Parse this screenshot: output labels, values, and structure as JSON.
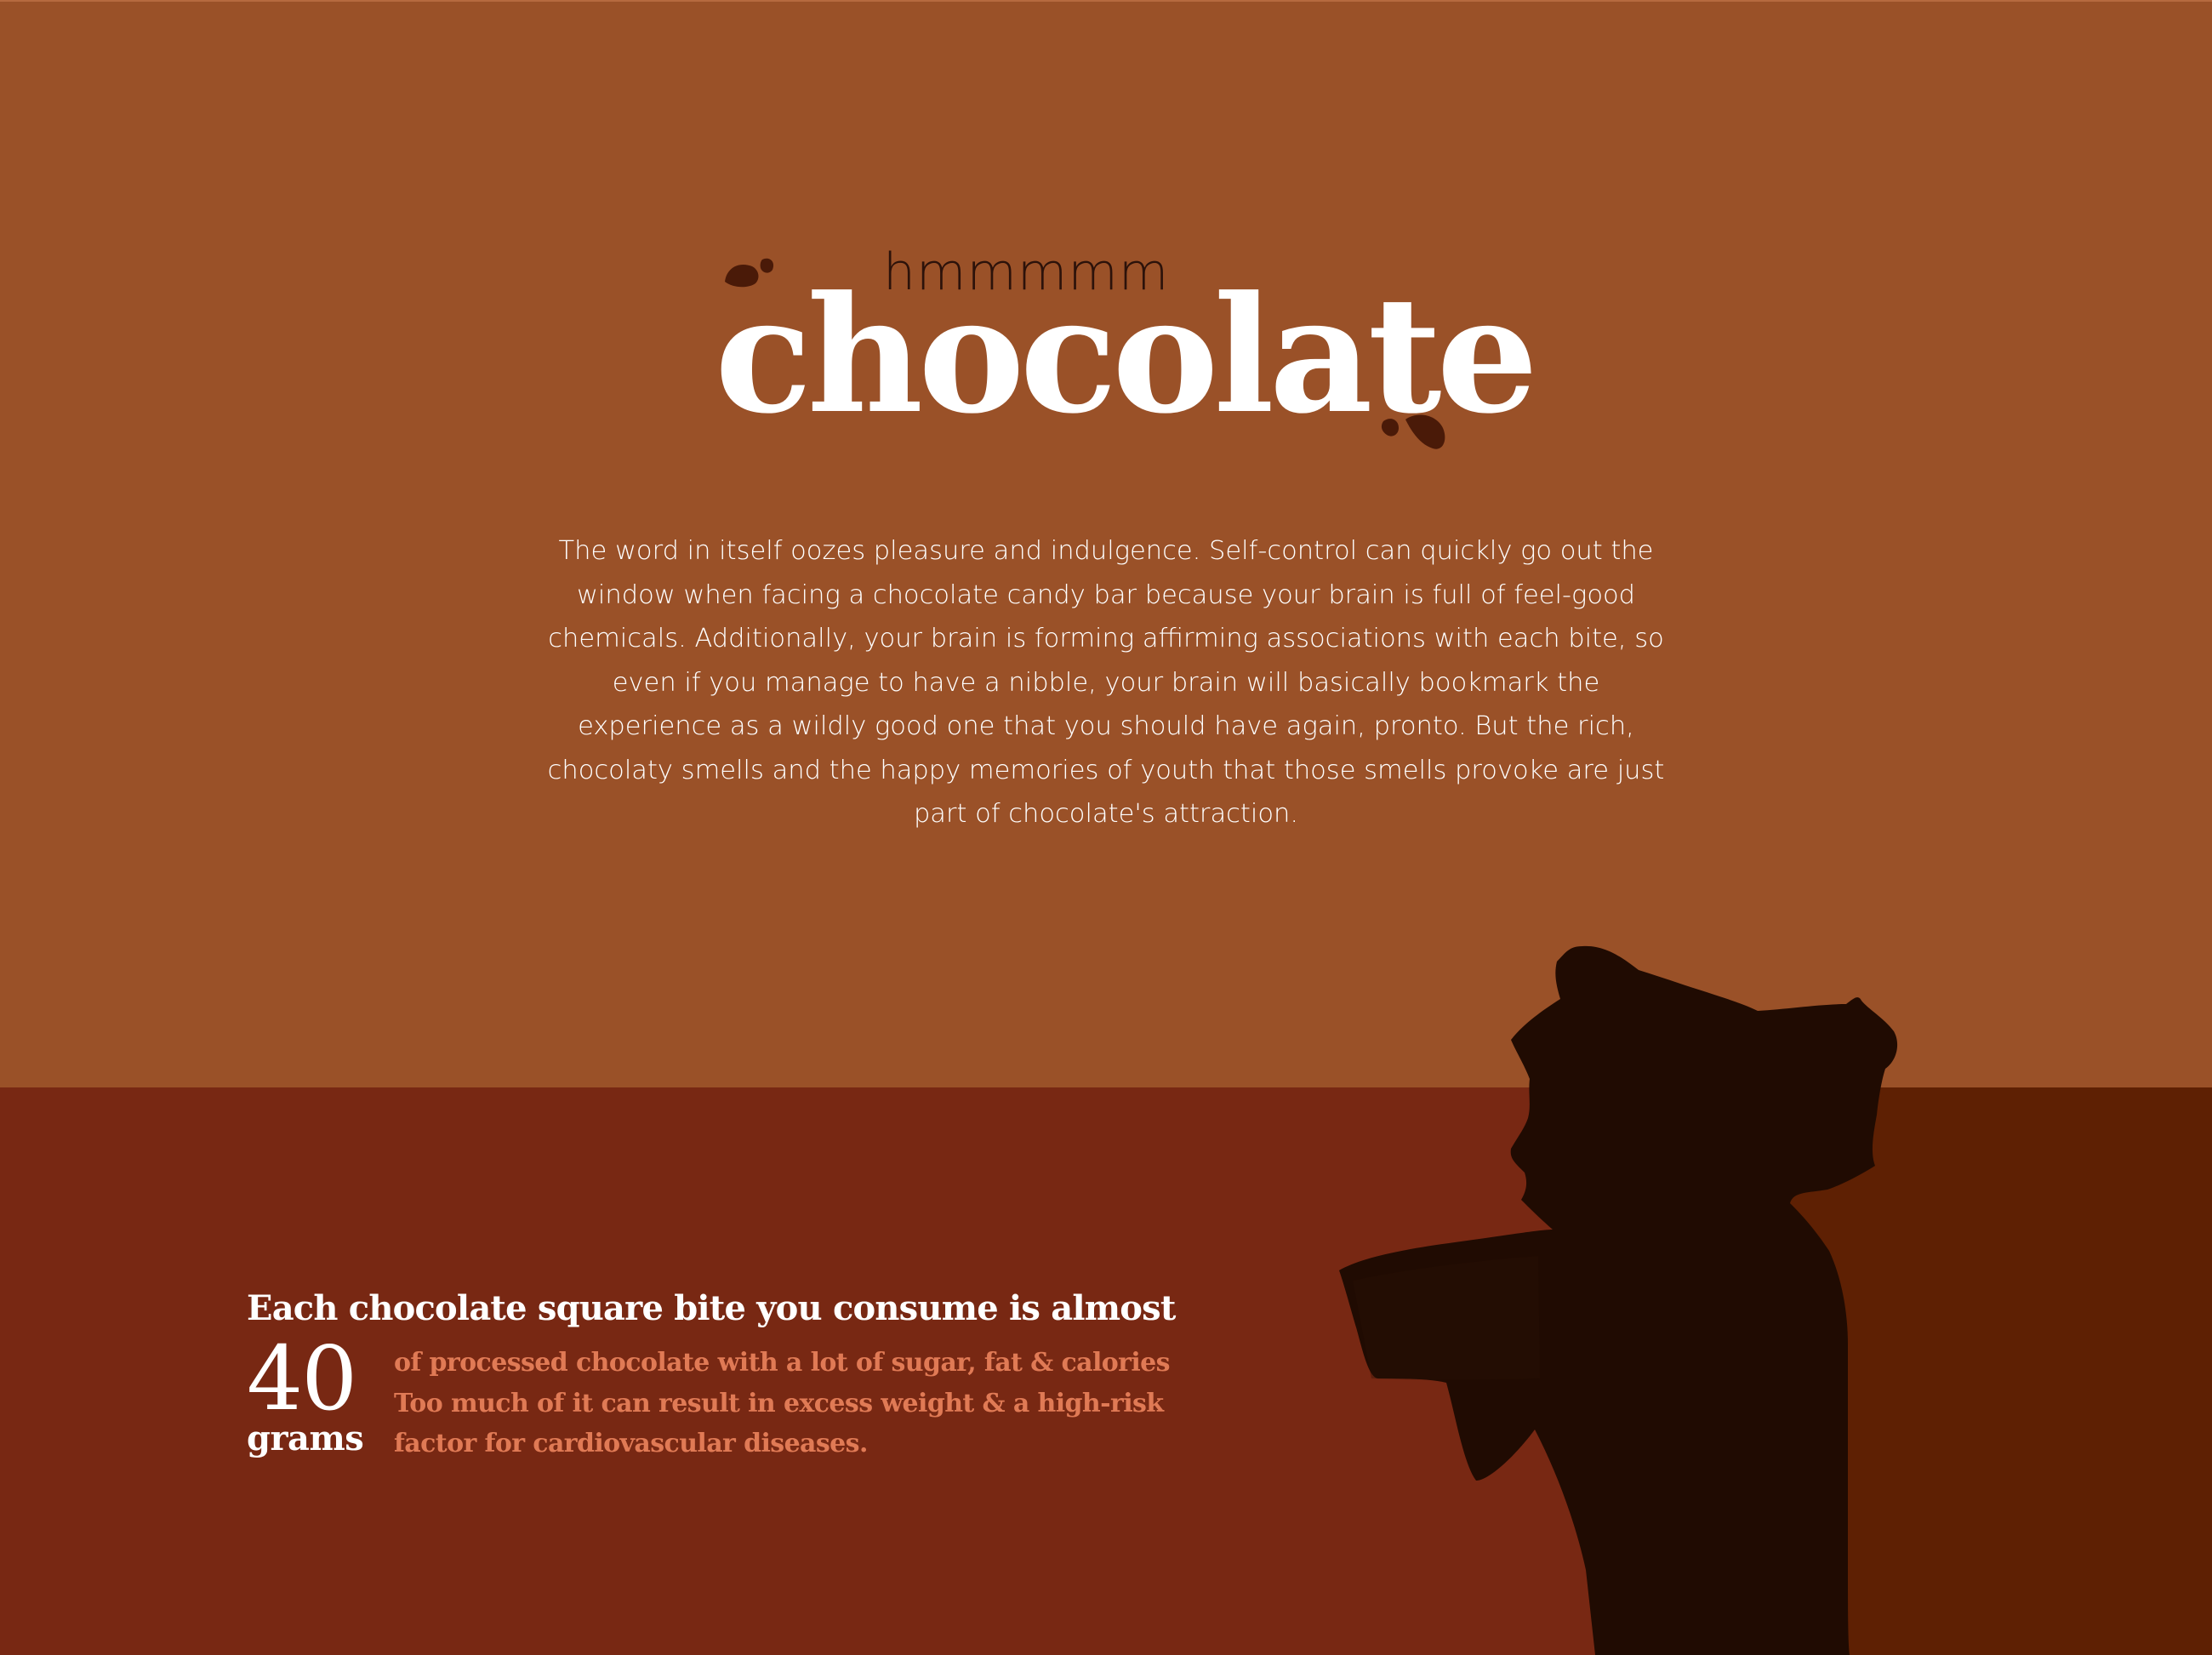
{
  "header": {
    "subtitle": "hmmmmm",
    "title": "chocolate"
  },
  "intro": {
    "text": "The word in itself oozes pleasure and indulgence. Self-control can quickly go out the window when facing a chocolate candy bar because your brain is full of feel-good chemicals. Additionally, your brain is forming affirming associations with each bite, so even if you manage to have a nibble, your brain will basically bookmark the experience as a wildly good one that you should have again, pronto. But the rich, chocolaty smells and the happy memories of youth that those smells provoke are just part of chocolate's attraction."
  },
  "fact": {
    "heading": "Each chocolate square bite you consume is almost",
    "number": "40",
    "unit": "grams",
    "detail_lines": [
      "of processed chocolate with a lot of sugar, fat & calories",
      "Too much of it can result in excess weight & a high-risk",
      "factor for cardiovascular diseases."
    ]
  },
  "colors": {
    "top_background": "#9a5128",
    "bottom_background": "#782813",
    "bottom_background_dark": "#5e2003",
    "silhouette": "#200b02",
    "accent_text": "#e07a55",
    "drops": "#4a1a08"
  },
  "icons": {
    "drops": "chocolate-drop-icon",
    "figure": "person-eating-chocolate-silhouette"
  }
}
